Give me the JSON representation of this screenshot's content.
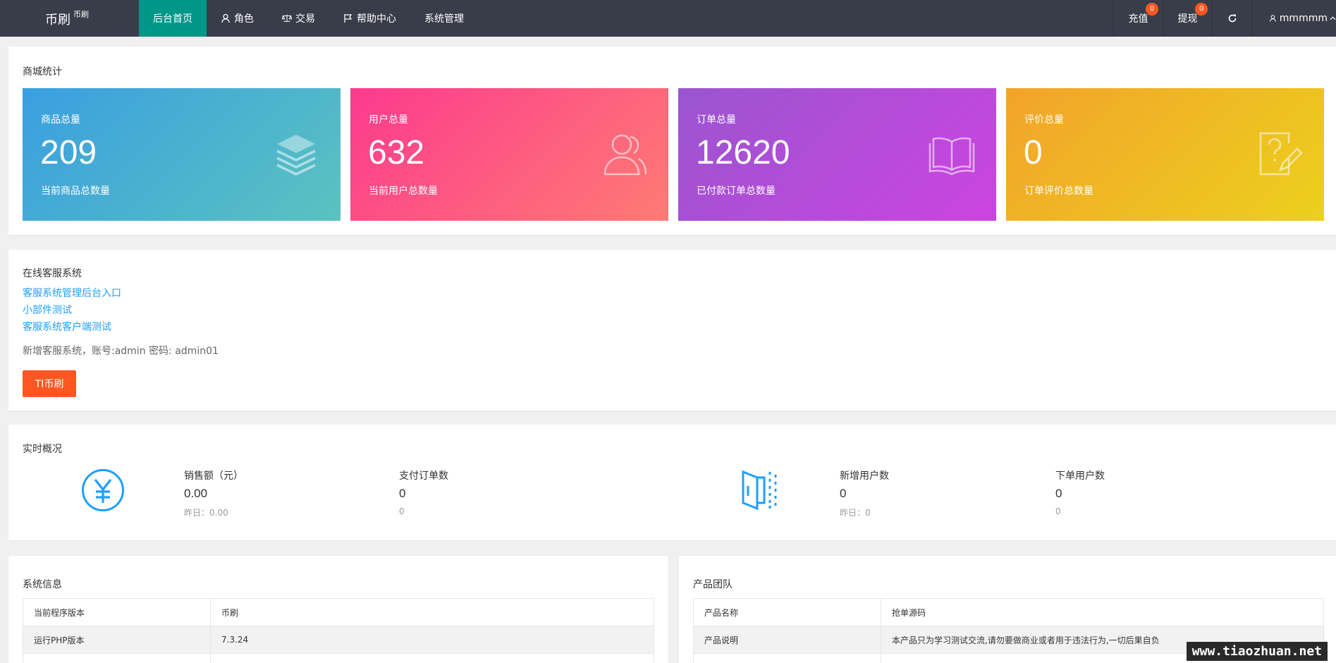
{
  "topbar": {
    "brand": "币刷",
    "brand_small": "币刷",
    "nav": [
      {
        "label": "后台首页",
        "icon": ""
      },
      {
        "label": "角色",
        "icon": "user-icon"
      },
      {
        "label": "交易",
        "icon": "scale-icon"
      },
      {
        "label": "帮助中心",
        "icon": "flag-icon"
      },
      {
        "label": "系统管理",
        "icon": ""
      }
    ],
    "recharge": {
      "label": "充值",
      "badge": "0"
    },
    "withdraw": {
      "label": "提现",
      "badge": "0"
    },
    "refresh_icon": "refresh-icon",
    "user": "mmmmm"
  },
  "stats_card": {
    "title": "商城统计",
    "items": [
      {
        "label": "商品总量",
        "value": "209",
        "sub": "当前商品总数量",
        "icon": "layers-icon",
        "colors": [
          "#3a9fe0",
          "#5bc2c0"
        ]
      },
      {
        "label": "用户总量",
        "value": "632",
        "sub": "当前用户总数量",
        "icon": "users-icon",
        "colors": [
          "#fc3a8e",
          "#ff7b74"
        ]
      },
      {
        "label": "订单总量",
        "value": "12620",
        "sub": "已付款订单总数量",
        "icon": "book-icon",
        "colors": [
          "#9a55d0",
          "#cc44e0"
        ]
      },
      {
        "label": "评价总量",
        "value": "0",
        "sub": "订单评价总数量",
        "icon": "question-edit-icon",
        "colors": [
          "#f2a32b",
          "#ecd01d"
        ]
      }
    ]
  },
  "service_card": {
    "title": "在线客服系统",
    "links": [
      "客服系统管理后台入口",
      "小部件测试",
      "客服系统客户端测试"
    ],
    "note": "新增客服系统，账号:admin 密码: admin01",
    "button": "TI币刷"
  },
  "realtime_card": {
    "title": "实时概况",
    "left_icon": "yuan-icon",
    "right_icon": "door-icon",
    "kpis": [
      {
        "label": "销售额（元）",
        "value": "0.00",
        "sub": "昨日：0.00"
      },
      {
        "label": "支付订单数",
        "value": "0",
        "sub": "0"
      },
      {
        "label": "新增用户数",
        "value": "0",
        "sub": "昨日：0"
      },
      {
        "label": "下单用户数",
        "value": "0",
        "sub": "0"
      }
    ]
  },
  "system_card": {
    "title": "系统信息",
    "rows": [
      {
        "k": "当前程序版本",
        "v": "币刷"
      },
      {
        "k": "运行PHP版本",
        "v": "7.3.24"
      }
    ]
  },
  "team_card": {
    "title": "产品团队",
    "rows": [
      {
        "k": "产品名称",
        "v": "抢单源码"
      },
      {
        "k": "产品说明",
        "v": "本产品只为学习测试交流,请勿要做商业或者用于违法行为,一切后果自负"
      }
    ]
  },
  "watermark": "www.tiaozhuan.net",
  "accent": "#009688",
  "link_color": "#1e9fff",
  "button_color": "#ff5722"
}
